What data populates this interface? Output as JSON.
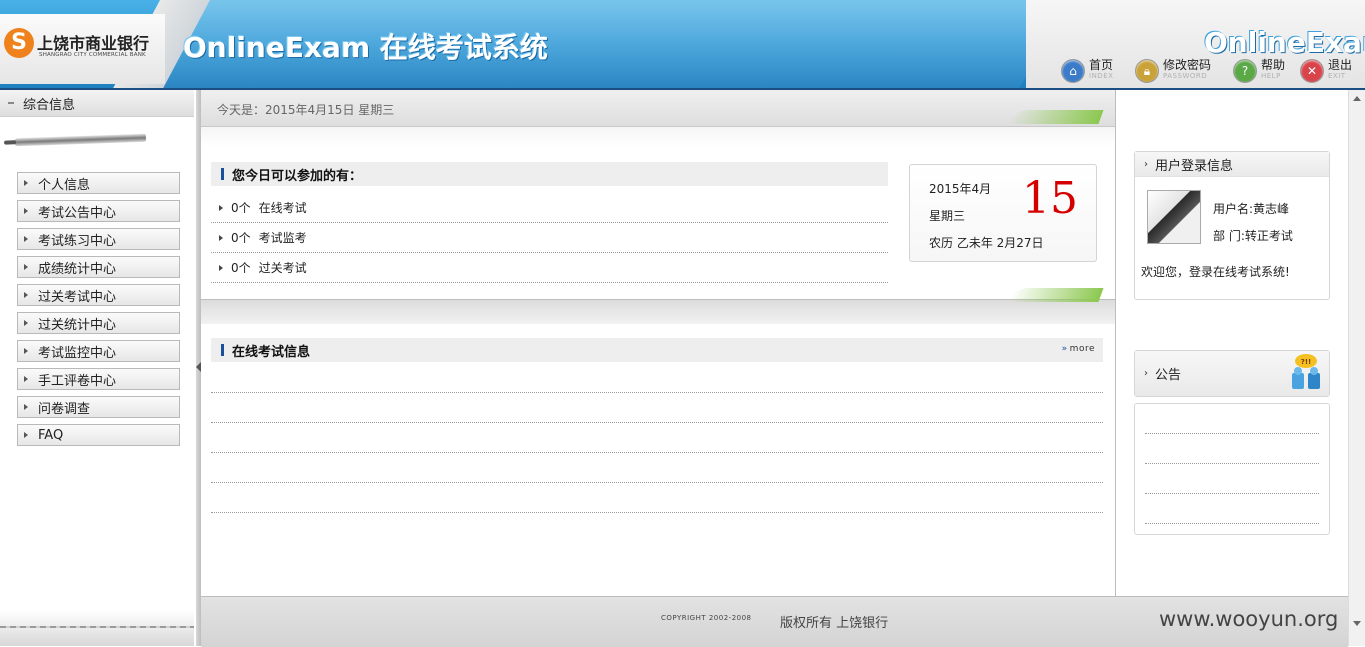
{
  "header": {
    "bank_logo_glyph": "S",
    "bank_name": "上饶市商业银行",
    "bank_name_en": "SHANGRAO CITY COMMERCIAL BANK",
    "title": "OnlineExam 在线考试系统",
    "right_title": "OnlineExam",
    "toolbar": [
      {
        "label": "首页",
        "sub": "INDEX",
        "icon": "home-icon",
        "color": "#3b7bc8"
      },
      {
        "label": "修改密码",
        "sub": "PASSWORD",
        "icon": "lock-icon",
        "color": "#c9a23a"
      },
      {
        "label": "帮助",
        "sub": "HELP",
        "icon": "help-icon",
        "color": "#5aa846"
      },
      {
        "label": "退出",
        "sub": "EXIT",
        "icon": "exit-icon",
        "color": "#d9434a"
      }
    ]
  },
  "sidebar": {
    "title": "综合信息",
    "items": [
      {
        "label": "个人信息"
      },
      {
        "label": "考试公告中心"
      },
      {
        "label": "考试练习中心"
      },
      {
        "label": "成绩统计中心"
      },
      {
        "label": "过关考试中心"
      },
      {
        "label": "过关统计中心"
      },
      {
        "label": "考试监控中心"
      },
      {
        "label": "手工评卷中心"
      },
      {
        "label": "问卷调查"
      },
      {
        "label": "FAQ"
      }
    ]
  },
  "main": {
    "today_text": "今天是：2015年4月15日  星期三",
    "available": {
      "title": "您今日可以参加的有：",
      "rows": [
        {
          "count": "0个",
          "name": "在线考试"
        },
        {
          "count": "0个",
          "name": "考试监考"
        },
        {
          "count": "0个",
          "name": "过关考试"
        }
      ]
    },
    "calendar": {
      "year_month": "2015年4月",
      "weekday": "星期三",
      "lunar": "农历  乙未年  2月27日",
      "day": "15"
    },
    "exam_info": {
      "title": "在线考试信息",
      "more": "more"
    }
  },
  "right": {
    "login_box": {
      "title": "用户登录信息",
      "username_line": "用户名:黄志峰",
      "dept_line": "部    门:转正考试",
      "welcome": "欢迎您，登录在线考试系统!"
    },
    "notice_box": {
      "title": "公告",
      "badge": "?!!"
    }
  },
  "footer": {
    "copyright": "COPYRIGHT 2002-2008",
    "rights": "版权所有  上饶银行",
    "site": "www.wooyun.org"
  }
}
